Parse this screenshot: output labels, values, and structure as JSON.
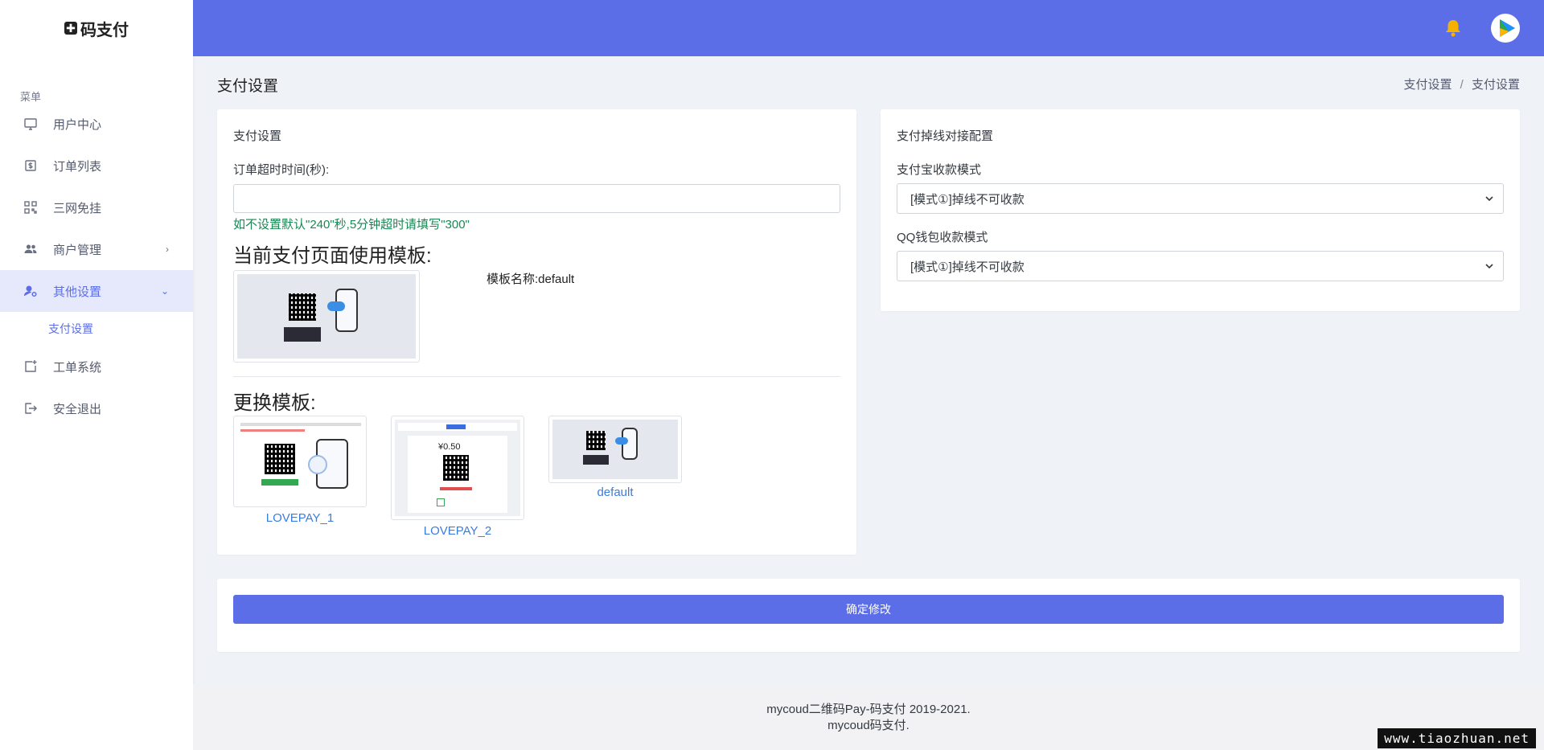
{
  "brand": {
    "logo_glyph": "✚",
    "name": "码支付"
  },
  "sidebar": {
    "menu_title": "菜单",
    "items": [
      {
        "label": "用户中心",
        "icon": "monitor-icon"
      },
      {
        "label": "订单列表",
        "icon": "dollar-document-icon"
      },
      {
        "label": "三网免挂",
        "icon": "qr-grid-icon"
      },
      {
        "label": "商户管理",
        "icon": "users-icon",
        "chevron": "›"
      },
      {
        "label": "其他设置",
        "icon": "user-gear-icon",
        "chevron": "⌄",
        "active": true
      },
      {
        "label": "工单系统",
        "icon": "ticket-add-icon"
      },
      {
        "label": "安全退出",
        "icon": "logout-icon"
      }
    ],
    "sub_item": "支付设置"
  },
  "header": {
    "bell_icon": "bell-icon",
    "avatar_icon": "play-avatar-icon",
    "accent": "#5b6ee8"
  },
  "page": {
    "title": "支付设置",
    "breadcrumb": [
      "支付设置",
      "支付设置"
    ],
    "breadcrumb_sep": "/"
  },
  "left_card": {
    "title": "支付设置",
    "timeout_label": "订单超时时间(秒):",
    "timeout_value": "",
    "timeout_hint": "如不设置默认\"240\"秒,5分钟超时请填写\"300\"",
    "current_template_heading": "当前支付页面使用模板:",
    "template_name_label": "模板名称:default",
    "change_template_heading": "更换模板:",
    "templates": [
      "LOVEPAY_1",
      "LOVEPAY_2",
      "default"
    ]
  },
  "right_card": {
    "title": "支付掉线对接配置",
    "alipay_label": "支付宝收款模式",
    "alipay_value": "[模式①]掉线不可收款",
    "qq_label": "QQ钱包收款模式",
    "qq_value": "[模式①]掉线不可收款"
  },
  "submit": {
    "label": "确定修改"
  },
  "footer": {
    "line1": "mycoud二维码Pay-码支付 2019-2021.",
    "line2": "mycoud码支付."
  },
  "watermark": "www.tiaozhuan.net"
}
